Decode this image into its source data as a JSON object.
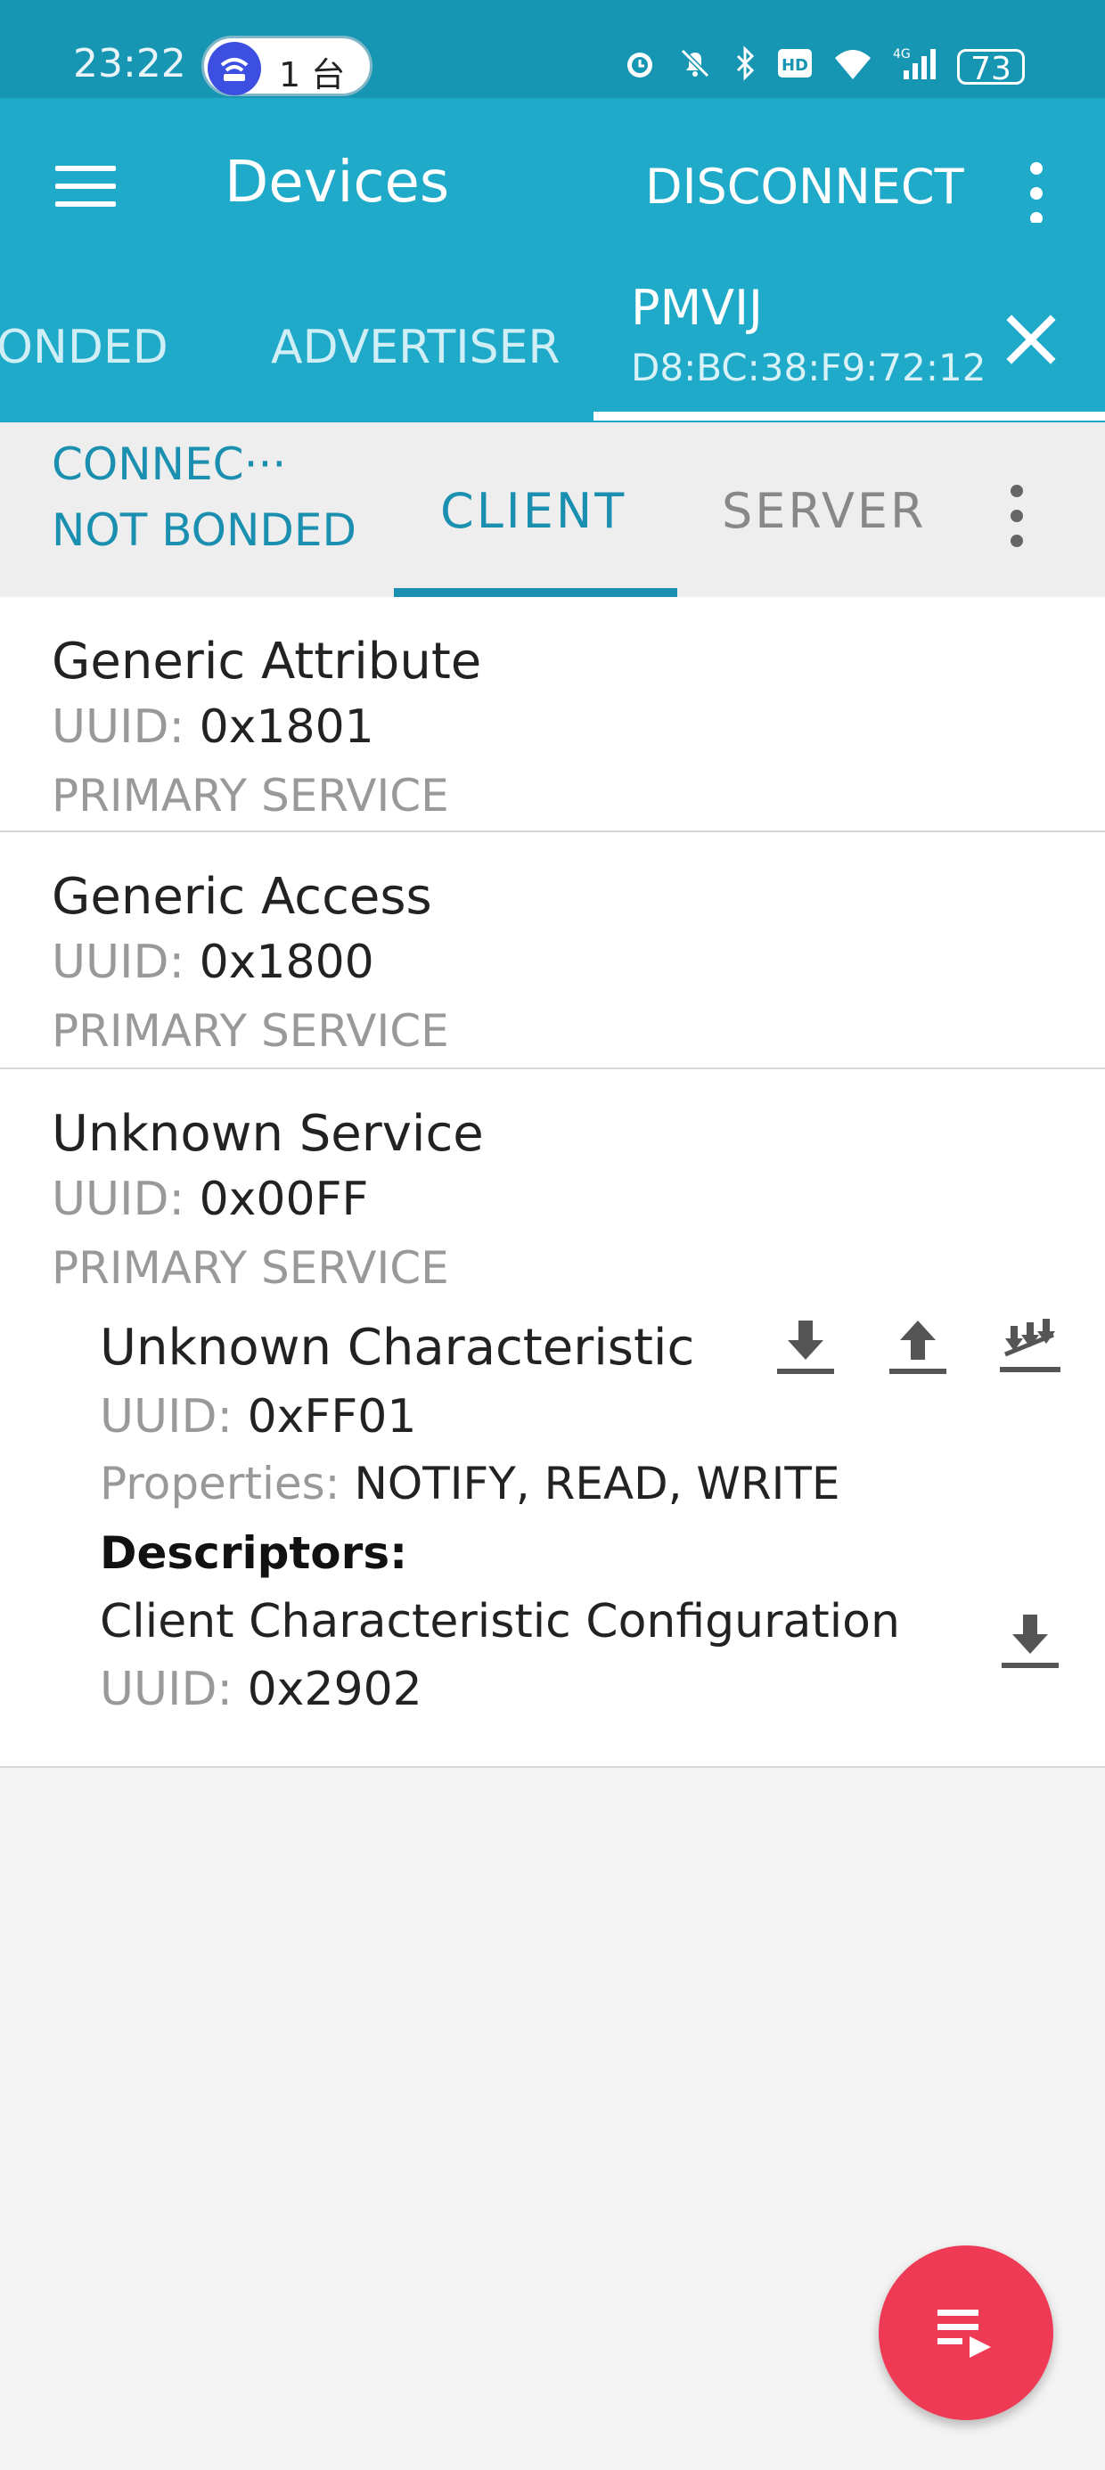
{
  "status_bar": {
    "time": "23:22",
    "pill_text": "1 台",
    "battery": "73",
    "network": "4G",
    "hd": "HD"
  },
  "app_bar": {
    "title": "Devices",
    "disconnect_label": "DISCONNECT"
  },
  "device_tabs": {
    "bonded_label": "ONDED",
    "advertiser_label": "ADVERTISER",
    "device_name": "PMVIJ",
    "device_mac": "D8:BC:38:F9:72:12"
  },
  "sub_tabs": {
    "connection_state": "CONNEC···",
    "bond_state": "NOT BONDED",
    "client_label": "CLIENT",
    "server_label": "SERVER"
  },
  "uuid_label": "UUID:",
  "properties_label": "Properties:",
  "services": [
    {
      "name": "Generic Attribute",
      "uuid": "0x1801",
      "type": "PRIMARY SERVICE"
    },
    {
      "name": "Generic Access",
      "uuid": "0x1800",
      "type": "PRIMARY SERVICE"
    },
    {
      "name": "Unknown Service",
      "uuid": "0x00FF",
      "type": "PRIMARY SERVICE"
    }
  ],
  "characteristic": {
    "name": "Unknown Characteristic",
    "uuid": "0xFF01",
    "properties": "NOTIFY, READ, WRITE",
    "descriptors_label": "Descriptors:",
    "descriptor_name": "Client Characteristic Configuration",
    "descriptor_uuid": "0x2902"
  },
  "colors": {
    "status_bar": "#1796b4",
    "app_bar": "#1eaac8",
    "accent": "#1a8fb0",
    "fab": "#ee3a55"
  },
  "icons": {
    "menu": "hamburger-icon",
    "overflow": "more-vert-icon",
    "close": "close-icon",
    "read": "download-icon",
    "write": "upload-icon",
    "notify": "notify-multiple-download-icon",
    "fab": "log-list-icon"
  }
}
